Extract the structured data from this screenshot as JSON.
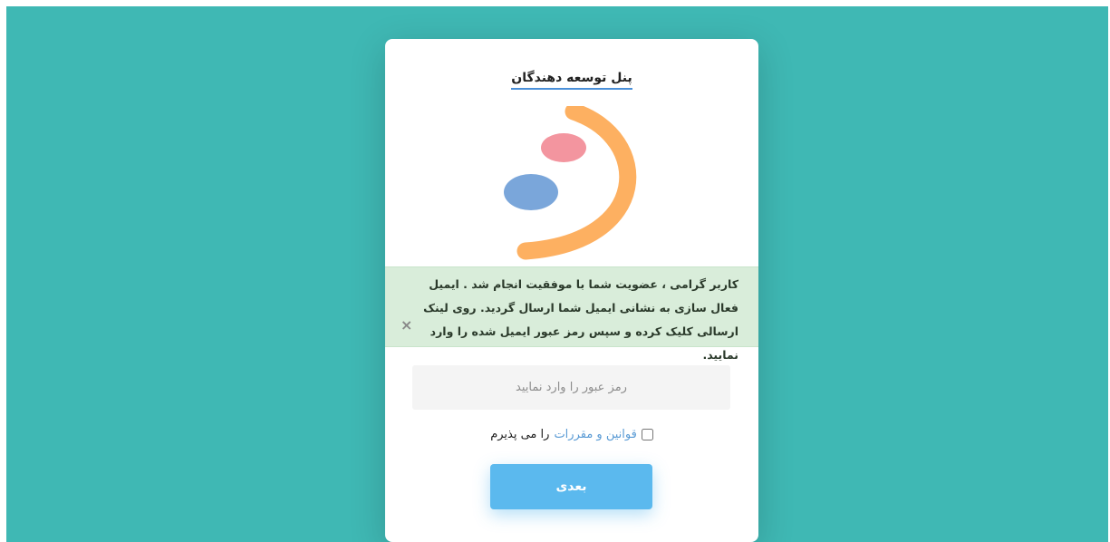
{
  "header": {
    "title": "پنل توسعه دهندگان"
  },
  "logo": {
    "icon": "smile-logo-icon",
    "colors": {
      "arc": "#fdb061",
      "dot_small": "#f3959f",
      "dot_large": "#7aa6da"
    }
  },
  "alert": {
    "message": "کاربر گرامی ، عضویت شما با موفقیت انجام شد . ایمیل فعال سازی به نشانی ایمیل شما ارسال گردید. روی لینک ارسالی کلیک کرده و سپس رمز عبور ایمیل شده را وارد نمایید.",
    "close_icon": "×",
    "background": "#d9edda"
  },
  "form": {
    "password": {
      "placeholder": "رمز عبور را وارد نمایید",
      "value": ""
    },
    "terms": {
      "link_text": "قوانین و مقررات",
      "suffix_text": "را می پذیرم",
      "checked": false
    },
    "next_button": {
      "label": "بعدی"
    }
  },
  "colors": {
    "background": "#3fb8b4",
    "card": "#ffffff",
    "button": "#5bb9ee",
    "link": "#5a9bd5"
  }
}
